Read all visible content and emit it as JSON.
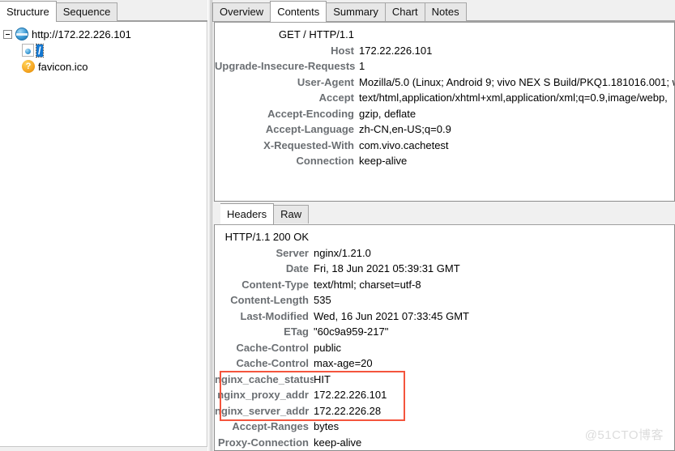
{
  "left_panel": {
    "tabs": [
      {
        "label": "Structure",
        "selected": true
      },
      {
        "label": "Sequence",
        "selected": false
      }
    ],
    "tree": {
      "root": {
        "icon": "globe-icon",
        "label": "http://172.22.226.101",
        "expanded": true
      },
      "children": [
        {
          "icon": "document-icon",
          "label": "/",
          "selected": true
        },
        {
          "icon": "question-icon",
          "label": "favicon.ico",
          "selected": false
        }
      ]
    }
  },
  "right_panel": {
    "tabs": [
      {
        "label": "Overview",
        "selected": false
      },
      {
        "label": "Contents",
        "selected": true
      },
      {
        "label": "Summary",
        "selected": false
      },
      {
        "label": "Chart",
        "selected": false
      },
      {
        "label": "Notes",
        "selected": false
      }
    ],
    "sub_tabs": [
      {
        "label": "Headers",
        "selected": true
      },
      {
        "label": "Raw",
        "selected": false
      }
    ],
    "request": {
      "status_line": "GET / HTTP/1.1",
      "headers": [
        {
          "name": "Host",
          "value": "172.22.226.101"
        },
        {
          "name": "Upgrade-Insecure-Requests",
          "value": "1"
        },
        {
          "name": "User-Agent",
          "value": "Mozilla/5.0 (Linux; Android 9; vivo NEX S Build/PKQ1.181016.001; w"
        },
        {
          "name": "Accept",
          "value": "text/html,application/xhtml+xml,application/xml;q=0.9,image/webp,"
        },
        {
          "name": "Accept-Encoding",
          "value": "gzip, deflate"
        },
        {
          "name": "Accept-Language",
          "value": "zh-CN,en-US;q=0.9"
        },
        {
          "name": "X-Requested-With",
          "value": "com.vivo.cachetest"
        },
        {
          "name": "Connection",
          "value": "keep-alive"
        }
      ]
    },
    "response": {
      "status_line": "HTTP/1.1 200 OK",
      "headers": [
        {
          "name": "Server",
          "value": "nginx/1.21.0",
          "highlighted": false
        },
        {
          "name": "Date",
          "value": "Fri, 18 Jun 2021 05:39:31 GMT",
          "highlighted": false
        },
        {
          "name": "Content-Type",
          "value": "text/html; charset=utf-8",
          "highlighted": false
        },
        {
          "name": "Content-Length",
          "value": "535",
          "highlighted": false
        },
        {
          "name": "Last-Modified",
          "value": "Wed, 16 Jun 2021 07:33:45 GMT",
          "highlighted": false
        },
        {
          "name": "ETag",
          "value": "\"60c9a959-217\"",
          "highlighted": false
        },
        {
          "name": "Cache-Control",
          "value": "public",
          "highlighted": false
        },
        {
          "name": "Cache-Control",
          "value": "max-age=20",
          "highlighted": false
        },
        {
          "name": "nginx_cache_status",
          "value": "HIT",
          "highlighted": true
        },
        {
          "name": "nginx_proxy_addr",
          "value": "172.22.226.101",
          "highlighted": true
        },
        {
          "name": "nginx_server_addr",
          "value": "172.22.226.28",
          "highlighted": true
        },
        {
          "name": "Accept-Ranges",
          "value": "bytes",
          "highlighted": false
        },
        {
          "name": "Proxy-Connection",
          "value": "keep-alive",
          "highlighted": false
        }
      ]
    }
  },
  "highlight_color": "#f4553d",
  "watermark": "@51CTO博客"
}
